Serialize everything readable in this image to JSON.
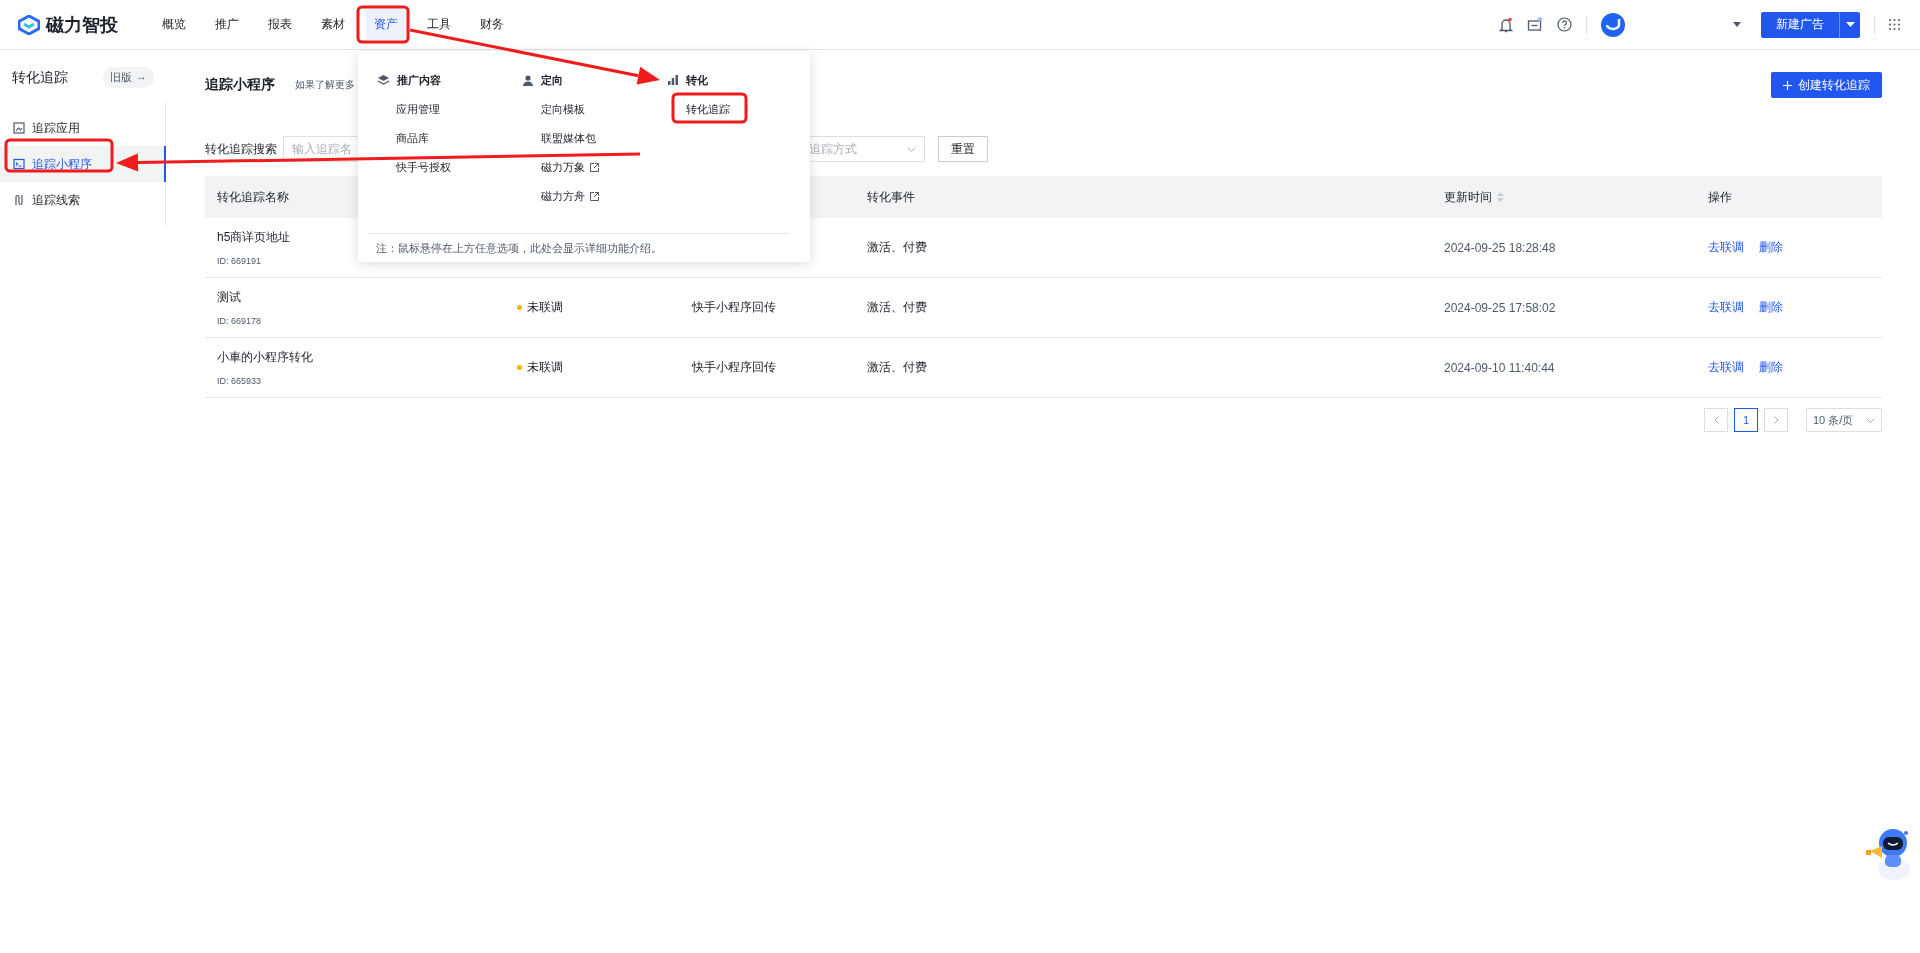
{
  "header": {
    "logo": "磁力智投",
    "nav": [
      {
        "label": "概览",
        "selected": false
      },
      {
        "label": "推广",
        "selected": false
      },
      {
        "label": "报表",
        "selected": false
      },
      {
        "label": "素材",
        "selected": false
      },
      {
        "label": "资产",
        "selected": true
      },
      {
        "label": "工具",
        "selected": false
      },
      {
        "label": "财务",
        "selected": false
      }
    ],
    "new_ad_button": "新建广告"
  },
  "sidebar": {
    "title": "转化追踪",
    "old_version": "旧版",
    "old_version_arrow": "→",
    "items": [
      {
        "label": "追踪应用",
        "kind": "app",
        "selected": false
      },
      {
        "label": "追踪小程序",
        "kind": "miniapp",
        "selected": true
      },
      {
        "label": "追踪线索",
        "kind": "lead",
        "selected": false
      }
    ]
  },
  "page": {
    "title": "追踪小程序",
    "subtitle": "如果了解更多",
    "create_button": "创建转化追踪"
  },
  "filters": {
    "label": "转化追踪搜索",
    "placeholder": "输入追踪名",
    "select_placeholder": "追踪方式",
    "reset_button": "重置"
  },
  "table": {
    "columns": [
      {
        "label": "转化追踪名称",
        "sortable": false
      },
      null,
      null,
      {
        "label": "转化事件",
        "sortable": false
      },
      {
        "label": "更新时间",
        "sortable": true
      },
      {
        "label": "操作",
        "sortable": false
      }
    ],
    "rows": [
      {
        "name": "h5商详页地址",
        "id": "ID: 669191",
        "event": "激活、付费",
        "updated": "2024-09-25 18:28:48",
        "actions": [
          "去联调",
          "删除"
        ]
      },
      {
        "name": "测试",
        "id": "ID: 669178",
        "status": "未联调",
        "source": "快手小程序回传",
        "event": "激活、付费",
        "updated": "2024-09-25 17:58:02",
        "actions": [
          "去联调",
          "删除"
        ]
      },
      {
        "name": "小車的小程序转化",
        "id": "ID: 665933",
        "status": "未联调",
        "source": "快手小程序回传",
        "event": "激活、付费",
        "updated": "2024-09-10 11:40:44",
        "actions": [
          "去联调",
          "删除"
        ]
      }
    ]
  },
  "pagination": {
    "pages": [
      {
        "label": "1",
        "selected": true
      }
    ],
    "page_size": "10 条/页"
  },
  "asset_menu": {
    "groups": [
      {
        "title": "推广内容",
        "kind": "content",
        "items": [
          {
            "label": "应用管理",
            "external": false
          },
          {
            "label": "商品库",
            "external": false
          },
          {
            "label": "快手号授权",
            "external": false
          }
        ]
      },
      {
        "title": "定向",
        "kind": "audience",
        "items": [
          {
            "label": "定向模板",
            "external": false
          },
          {
            "label": "联盟媒体包",
            "external": false
          },
          {
            "label": "磁力万象",
            "external": true
          },
          {
            "label": "磁力方舟",
            "external": true
          }
        ]
      },
      {
        "title": "转化",
        "kind": "conversion",
        "items": [
          {
            "label": "转化追踪",
            "external": false
          }
        ]
      }
    ],
    "note": "注：鼠标悬停在上方任意选项，此处会显示详细功能介绍。"
  }
}
